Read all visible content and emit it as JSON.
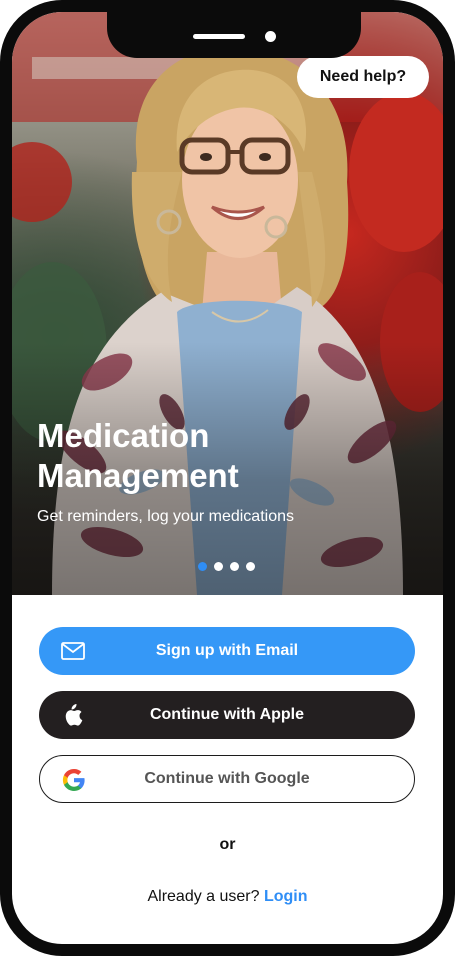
{
  "header": {
    "help_label": "Need help?"
  },
  "hero": {
    "title": "Medication Management",
    "subtitle": "Get reminders, log your medications",
    "slides": 4,
    "active_slide": 1
  },
  "auth": {
    "email_label": "Sign up with Email",
    "apple_label": "Continue with Apple",
    "google_label": "Continue with Google",
    "divider": "or",
    "login_prompt": "Already a user?",
    "login_link": "Login"
  },
  "icons": {
    "email": "envelope-icon",
    "apple": "apple-logo-icon",
    "google": "google-logo-icon"
  },
  "colors": {
    "primary": "#3598f7",
    "link": "#2f8ef6",
    "apple_button": "#231f20",
    "frame": "#0b0b0b"
  }
}
